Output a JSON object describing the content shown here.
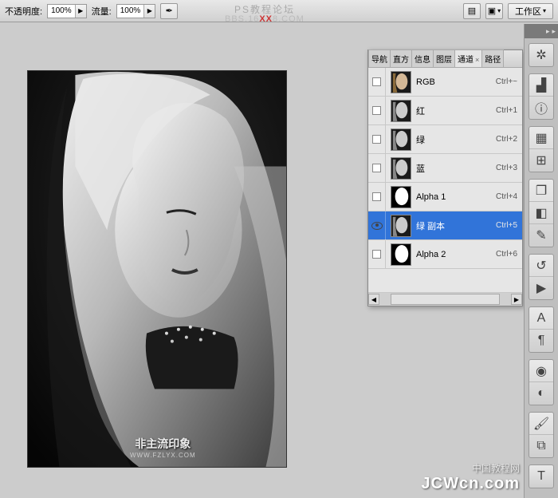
{
  "topbar": {
    "opacity_label": "不透明度:",
    "opacity_value": "100%",
    "flow_label": "流量:",
    "flow_value": "100%",
    "workspace_label": "工作区"
  },
  "banner": {
    "title": "PS教程论坛",
    "subtitle_pre": "BBS.16",
    "subtitle_hl": "XX",
    "subtitle_post": "8.COM"
  },
  "panel": {
    "tabs": [
      "导航",
      "直方",
      "信息",
      "图层",
      "通道",
      "路径"
    ],
    "active_tab_index": 4
  },
  "channels": [
    {
      "name": "RGB",
      "shortcut": "Ctrl+~",
      "thumb": "color",
      "visible": false,
      "selected": false
    },
    {
      "name": "红",
      "shortcut": "Ctrl+1",
      "thumb": "gray",
      "visible": false,
      "selected": false
    },
    {
      "name": "绿",
      "shortcut": "Ctrl+2",
      "thumb": "gray",
      "visible": false,
      "selected": false
    },
    {
      "name": "蓝",
      "shortcut": "Ctrl+3",
      "thumb": "gray",
      "visible": false,
      "selected": false
    },
    {
      "name": "Alpha 1",
      "shortcut": "Ctrl+4",
      "thumb": "mask",
      "visible": false,
      "selected": false
    },
    {
      "name": "绿 副本",
      "shortcut": "Ctrl+5",
      "thumb": "gray",
      "visible": true,
      "selected": true
    },
    {
      "name": "Alpha 2",
      "shortcut": "Ctrl+6",
      "thumb": "mask",
      "visible": false,
      "selected": false
    }
  ],
  "photo_watermark": {
    "line1": "非主流印象",
    "line2": "WWW.FZLYX.COM"
  },
  "site_watermark": {
    "line1": "中国教程网",
    "line2": "JCWcn.com"
  },
  "right_tools": {
    "groups": [
      [
        "wheel-icon"
      ],
      [
        "histogram-icon",
        "info-icon"
      ],
      [
        "swatches-icon",
        "crop-preset-icon"
      ],
      [
        "layers-icon",
        "channels-icon",
        "paths-icon"
      ],
      [
        "history-icon",
        "actions-icon"
      ],
      [
        "character-icon",
        "paragraph-icon"
      ],
      [
        "styles-icon",
        "adjust-icon"
      ],
      [
        "brush-icon",
        "clone-icon"
      ],
      [
        "type-icon"
      ]
    ]
  }
}
